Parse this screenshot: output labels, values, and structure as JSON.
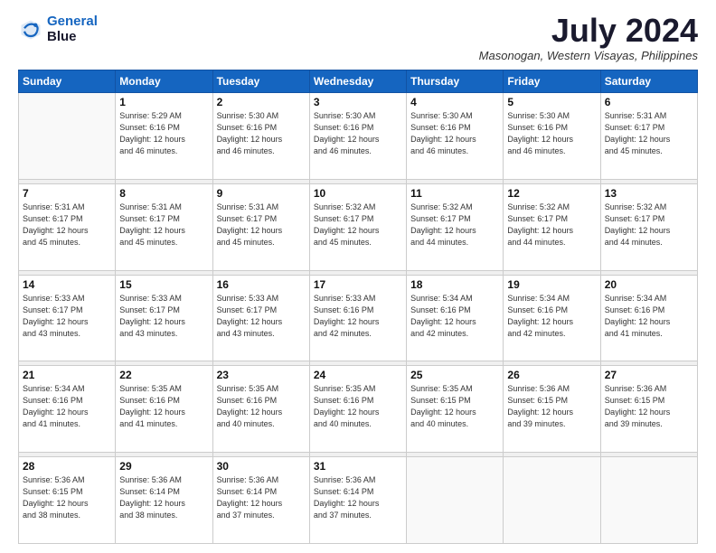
{
  "header": {
    "logo_line1": "General",
    "logo_line2": "Blue",
    "month": "July 2024",
    "location": "Masonogan, Western Visayas, Philippines"
  },
  "weekdays": [
    "Sunday",
    "Monday",
    "Tuesday",
    "Wednesday",
    "Thursday",
    "Friday",
    "Saturday"
  ],
  "weeks": [
    [
      {
        "day": "",
        "info": ""
      },
      {
        "day": "1",
        "info": "Sunrise: 5:29 AM\nSunset: 6:16 PM\nDaylight: 12 hours\nand 46 minutes."
      },
      {
        "day": "2",
        "info": "Sunrise: 5:30 AM\nSunset: 6:16 PM\nDaylight: 12 hours\nand 46 minutes."
      },
      {
        "day": "3",
        "info": "Sunrise: 5:30 AM\nSunset: 6:16 PM\nDaylight: 12 hours\nand 46 minutes."
      },
      {
        "day": "4",
        "info": "Sunrise: 5:30 AM\nSunset: 6:16 PM\nDaylight: 12 hours\nand 46 minutes."
      },
      {
        "day": "5",
        "info": "Sunrise: 5:30 AM\nSunset: 6:16 PM\nDaylight: 12 hours\nand 46 minutes."
      },
      {
        "day": "6",
        "info": "Sunrise: 5:31 AM\nSunset: 6:17 PM\nDaylight: 12 hours\nand 45 minutes."
      }
    ],
    [
      {
        "day": "7",
        "info": "Sunrise: 5:31 AM\nSunset: 6:17 PM\nDaylight: 12 hours\nand 45 minutes."
      },
      {
        "day": "8",
        "info": "Sunrise: 5:31 AM\nSunset: 6:17 PM\nDaylight: 12 hours\nand 45 minutes."
      },
      {
        "day": "9",
        "info": "Sunrise: 5:31 AM\nSunset: 6:17 PM\nDaylight: 12 hours\nand 45 minutes."
      },
      {
        "day": "10",
        "info": "Sunrise: 5:32 AM\nSunset: 6:17 PM\nDaylight: 12 hours\nand 45 minutes."
      },
      {
        "day": "11",
        "info": "Sunrise: 5:32 AM\nSunset: 6:17 PM\nDaylight: 12 hours\nand 44 minutes."
      },
      {
        "day": "12",
        "info": "Sunrise: 5:32 AM\nSunset: 6:17 PM\nDaylight: 12 hours\nand 44 minutes."
      },
      {
        "day": "13",
        "info": "Sunrise: 5:32 AM\nSunset: 6:17 PM\nDaylight: 12 hours\nand 44 minutes."
      }
    ],
    [
      {
        "day": "14",
        "info": "Sunrise: 5:33 AM\nSunset: 6:17 PM\nDaylight: 12 hours\nand 43 minutes."
      },
      {
        "day": "15",
        "info": "Sunrise: 5:33 AM\nSunset: 6:17 PM\nDaylight: 12 hours\nand 43 minutes."
      },
      {
        "day": "16",
        "info": "Sunrise: 5:33 AM\nSunset: 6:17 PM\nDaylight: 12 hours\nand 43 minutes."
      },
      {
        "day": "17",
        "info": "Sunrise: 5:33 AM\nSunset: 6:16 PM\nDaylight: 12 hours\nand 42 minutes."
      },
      {
        "day": "18",
        "info": "Sunrise: 5:34 AM\nSunset: 6:16 PM\nDaylight: 12 hours\nand 42 minutes."
      },
      {
        "day": "19",
        "info": "Sunrise: 5:34 AM\nSunset: 6:16 PM\nDaylight: 12 hours\nand 42 minutes."
      },
      {
        "day": "20",
        "info": "Sunrise: 5:34 AM\nSunset: 6:16 PM\nDaylight: 12 hours\nand 41 minutes."
      }
    ],
    [
      {
        "day": "21",
        "info": "Sunrise: 5:34 AM\nSunset: 6:16 PM\nDaylight: 12 hours\nand 41 minutes."
      },
      {
        "day": "22",
        "info": "Sunrise: 5:35 AM\nSunset: 6:16 PM\nDaylight: 12 hours\nand 41 minutes."
      },
      {
        "day": "23",
        "info": "Sunrise: 5:35 AM\nSunset: 6:16 PM\nDaylight: 12 hours\nand 40 minutes."
      },
      {
        "day": "24",
        "info": "Sunrise: 5:35 AM\nSunset: 6:16 PM\nDaylight: 12 hours\nand 40 minutes."
      },
      {
        "day": "25",
        "info": "Sunrise: 5:35 AM\nSunset: 6:15 PM\nDaylight: 12 hours\nand 40 minutes."
      },
      {
        "day": "26",
        "info": "Sunrise: 5:36 AM\nSunset: 6:15 PM\nDaylight: 12 hours\nand 39 minutes."
      },
      {
        "day": "27",
        "info": "Sunrise: 5:36 AM\nSunset: 6:15 PM\nDaylight: 12 hours\nand 39 minutes."
      }
    ],
    [
      {
        "day": "28",
        "info": "Sunrise: 5:36 AM\nSunset: 6:15 PM\nDaylight: 12 hours\nand 38 minutes."
      },
      {
        "day": "29",
        "info": "Sunrise: 5:36 AM\nSunset: 6:14 PM\nDaylight: 12 hours\nand 38 minutes."
      },
      {
        "day": "30",
        "info": "Sunrise: 5:36 AM\nSunset: 6:14 PM\nDaylight: 12 hours\nand 37 minutes."
      },
      {
        "day": "31",
        "info": "Sunrise: 5:36 AM\nSunset: 6:14 PM\nDaylight: 12 hours\nand 37 minutes."
      },
      {
        "day": "",
        "info": ""
      },
      {
        "day": "",
        "info": ""
      },
      {
        "day": "",
        "info": ""
      }
    ]
  ]
}
